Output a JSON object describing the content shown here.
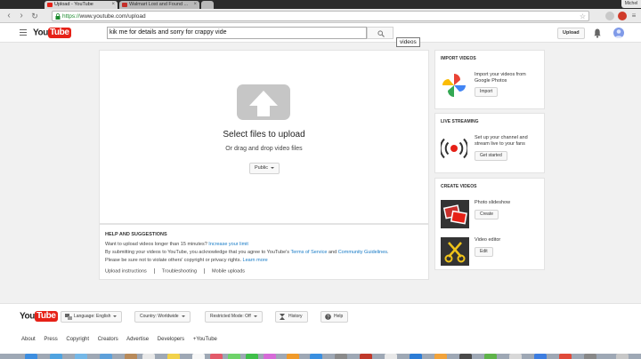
{
  "browser": {
    "tabs": [
      {
        "title": "Upload - YouTube",
        "active": true
      },
      {
        "title": "Walmart Lost and Found ...",
        "active": false
      }
    ],
    "user_chip": "Michel",
    "url_scheme": "https://",
    "url_rest": "www.youtube.com/upload"
  },
  "header": {
    "logo_you": "You",
    "logo_tube": "Tube",
    "search_value": "kik me for details and sorry for crappy vide",
    "search_tooltip": "videos",
    "upload_label": "Upload"
  },
  "upload": {
    "select_files": "Select files to upload",
    "drag_drop": "Or drag and drop video files",
    "privacy": "Public"
  },
  "help": {
    "title": "HELP AND SUGGESTIONS",
    "line1_text": "Want to upload videos longer than 15 minutes?",
    "line1_link": "Increase your limit",
    "line2_a": "By submitting your videos to YouTube, you acknowledge that you agree to YouTube's",
    "line2_link1": "Terms of Service",
    "line2_and": "and",
    "line2_link2": "Community Guidelines",
    "line3_text": "Please be sure not to violate others' copyright or privacy rights.",
    "line3_link": "Learn more",
    "links": [
      "Upload instructions",
      "Troubleshooting",
      "Mobile uploads"
    ]
  },
  "sidebar": {
    "import": {
      "title": "IMPORT VIDEOS",
      "text1": "Import your videos from",
      "text2": "Google Photos",
      "button": "Import"
    },
    "live": {
      "title": "LIVE STREAMING",
      "text1": "Set up your channel and",
      "text2": "stream live to your fans",
      "button": "Get started"
    },
    "create": {
      "title": "CREATE VIDEOS",
      "slideshow": {
        "label": "Photo slideshow",
        "button": "Create"
      },
      "editor": {
        "label": "Video editor",
        "button": "Edit"
      }
    }
  },
  "footer": {
    "logo_you": "You",
    "logo_tube": "Tube",
    "language": "Language: English",
    "country": "Country: Worldwide",
    "restricted": "Restricted Mode: Off",
    "history": "History",
    "help": "Help",
    "links": [
      "About",
      "Press",
      "Copyright",
      "Creators",
      "Advertise",
      "Developers",
      "+YouTube"
    ]
  },
  "colors": {
    "youtube_red": "#e62117",
    "link_blue": "#167ac6",
    "page_bg": "#f1f1f1"
  }
}
